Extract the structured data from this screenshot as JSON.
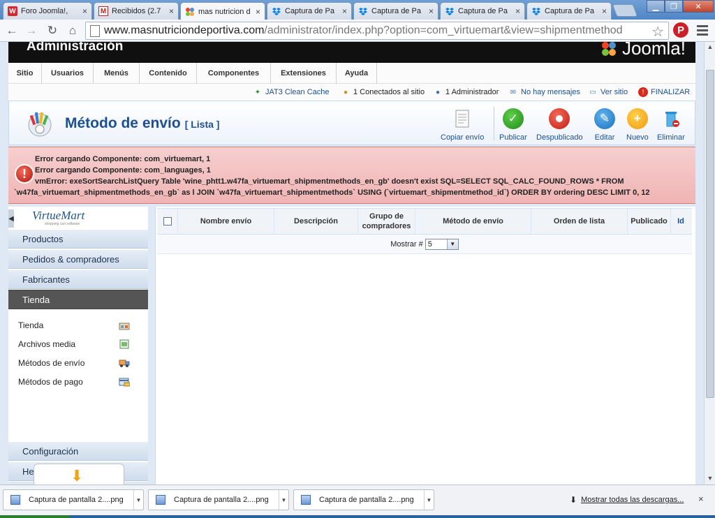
{
  "browser": {
    "tabs": [
      {
        "label": "Foro Joomla!, ",
        "icon": "w-logo-icon",
        "color": "#d9272e"
      },
      {
        "label": "Recibidos (2.7",
        "icon": "gmail-icon",
        "color": "#c5221f"
      },
      {
        "label": "mas nutricion d",
        "icon": "joomla-icon",
        "color": "#5091cd"
      },
      {
        "label": "Captura de Pa",
        "icon": "dropbox-icon",
        "color": "#007ee5"
      },
      {
        "label": "Captura de Pa",
        "icon": "dropbox-icon",
        "color": "#007ee5"
      },
      {
        "label": "Captura de Pa",
        "icon": "dropbox-icon",
        "color": "#007ee5"
      },
      {
        "label": "Captura de Pa",
        "icon": "dropbox-icon",
        "color": "#007ee5"
      }
    ],
    "close_glyph": "×",
    "url_host": "www.masnutriciondeportiva.com",
    "url_path": "/administrator/index.php?option=com_virtuemart&view=shipmentmethod"
  },
  "header": {
    "title": "Administración",
    "logo_text": "Joomla!"
  },
  "menu": [
    {
      "label": "Sitio"
    },
    {
      "label": "Usuarios"
    },
    {
      "label": "Menús"
    },
    {
      "label": "Contenido"
    },
    {
      "label": "Componentes"
    },
    {
      "label": "Extensiones"
    },
    {
      "label": "Ayuda"
    }
  ],
  "status": {
    "cache": "JAT3 Clean Cache",
    "connected": "1 Conectados al sitio",
    "admins": "1 Administrador",
    "messages": "No hay mensajes",
    "view_site": "Ver sitio",
    "logout": "FINALIZAR"
  },
  "toolbar": {
    "title": "Método de envío",
    "subtitle": "[ Lista ]",
    "copy": "Copiar envío",
    "publish": "Publicar",
    "unpublish": "Despublicado",
    "edit": "Editar",
    "new": "Nuevo",
    "delete": "Eliminar"
  },
  "errors": [
    "Error cargando Componente: com_virtuemart, 1",
    "Error cargando Componente: com_languages, 1",
    "vmError: exeSortSearchListQuery Table 'wine_phtt1.w47fa_virtuemart_shipmentmethods_en_gb' doesn't exist SQL=SELECT SQL_CALC_FOUND_ROWS * FROM",
    "`w47fa_virtuemart_shipmentmethods_en_gb` as l JOIN `w47fa_virtuemart_shipmentmethods` USING (`virtuemart_shipmentmethod_id`) ORDER BY ordering DESC LIMIT 0, 12"
  ],
  "sidebar": {
    "logo": "VirtueMart",
    "logo_sub": "shopping cart software",
    "sections": [
      {
        "label": "Productos"
      },
      {
        "label": "Pedidos & compradores"
      },
      {
        "label": "Fabricantes"
      },
      {
        "label": "Tienda"
      }
    ],
    "shop_items": [
      {
        "label": "Tienda"
      },
      {
        "label": "Archivos media"
      },
      {
        "label": "Métodos de envío"
      },
      {
        "label": "Métodos de pago"
      }
    ],
    "bottom_sections": [
      {
        "label": "Configuración"
      },
      {
        "label": "Herramientas"
      }
    ]
  },
  "table": {
    "columns": [
      "Nombre envío",
      "Descripción",
      "Grupo de compradores",
      "Método de envío",
      "Orden de lista",
      "Publicado",
      "Id"
    ],
    "pager_label": "Mostrar #",
    "pager_value": "5"
  },
  "downloads": {
    "items": [
      {
        "label": "Captura de pantalla 2....png"
      },
      {
        "label": "Captura de pantalla 2....png"
      },
      {
        "label": "Captura de pantalla 2....png"
      }
    ],
    "show_all": "Mostrar todas las descargas...",
    "close_glyph": "×"
  }
}
